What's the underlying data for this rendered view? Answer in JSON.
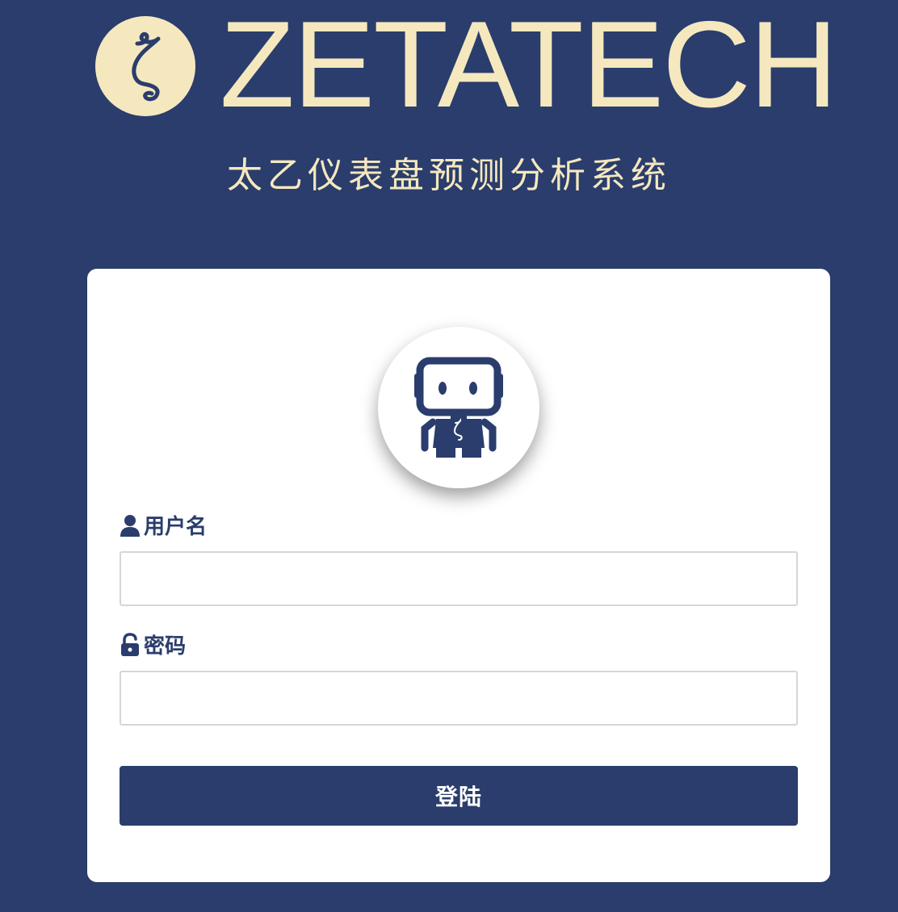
{
  "brand": {
    "logo_icon": "zeta-logo-icon",
    "wordmark": "ZETATECH",
    "subtitle": "太乙仪表盘预测分析系统"
  },
  "login_form": {
    "avatar_icon": "robot-icon",
    "username": {
      "icon": "user-icon",
      "label": "用户名",
      "value": "",
      "placeholder": ""
    },
    "password": {
      "icon": "unlock-icon",
      "label": "密码",
      "value": "",
      "placeholder": ""
    },
    "submit_label": "登陆"
  },
  "colors": {
    "background": "#2a3d6c",
    "brand_cream": "#f5e8bf",
    "card": "#ffffff",
    "primary": "#2a3d6c"
  }
}
